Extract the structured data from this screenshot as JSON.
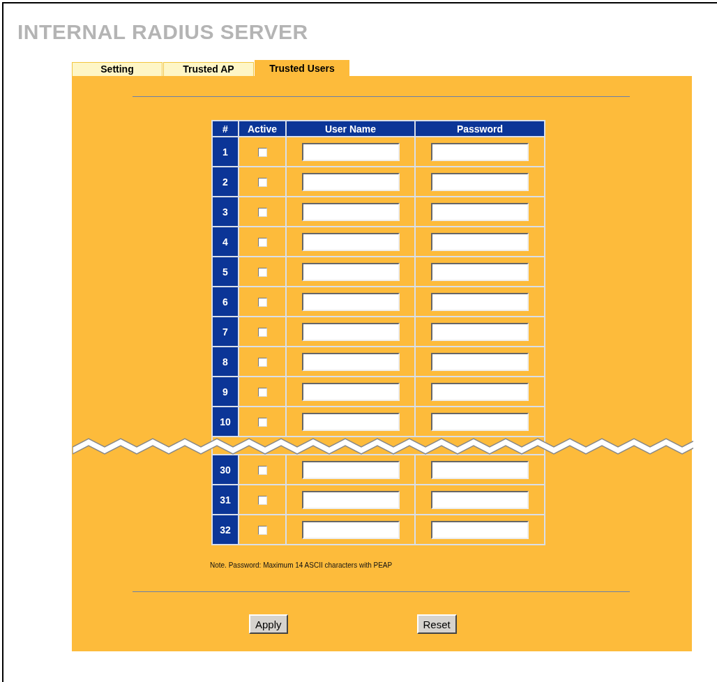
{
  "title": "INTERNAL RADIUS SERVER",
  "tabs": [
    {
      "label": "Setting",
      "selected": false
    },
    {
      "label": "Trusted AP",
      "selected": false
    },
    {
      "label": "Trusted Users",
      "selected": true
    }
  ],
  "table": {
    "columns": [
      "#",
      "Active",
      "User Name",
      "Password"
    ],
    "rows": [
      {
        "number": "1",
        "active": false
      },
      {
        "number": "2",
        "active": false
      },
      {
        "number": "3",
        "active": false
      },
      {
        "number": "4",
        "active": false
      },
      {
        "number": "5",
        "active": false
      },
      {
        "number": "6",
        "active": false
      },
      {
        "number": "7",
        "active": false
      },
      {
        "number": "8",
        "active": false
      },
      {
        "number": "9",
        "active": false
      },
      {
        "number": "10",
        "active": false
      },
      {
        "number": "30",
        "active": false
      },
      {
        "number": "31",
        "active": false
      },
      {
        "number": "32",
        "active": false
      }
    ]
  },
  "note": "Note. Password: Maximum 14 ASCII characters with PEAP",
  "buttons": [
    "Apply",
    "Reset"
  ]
}
